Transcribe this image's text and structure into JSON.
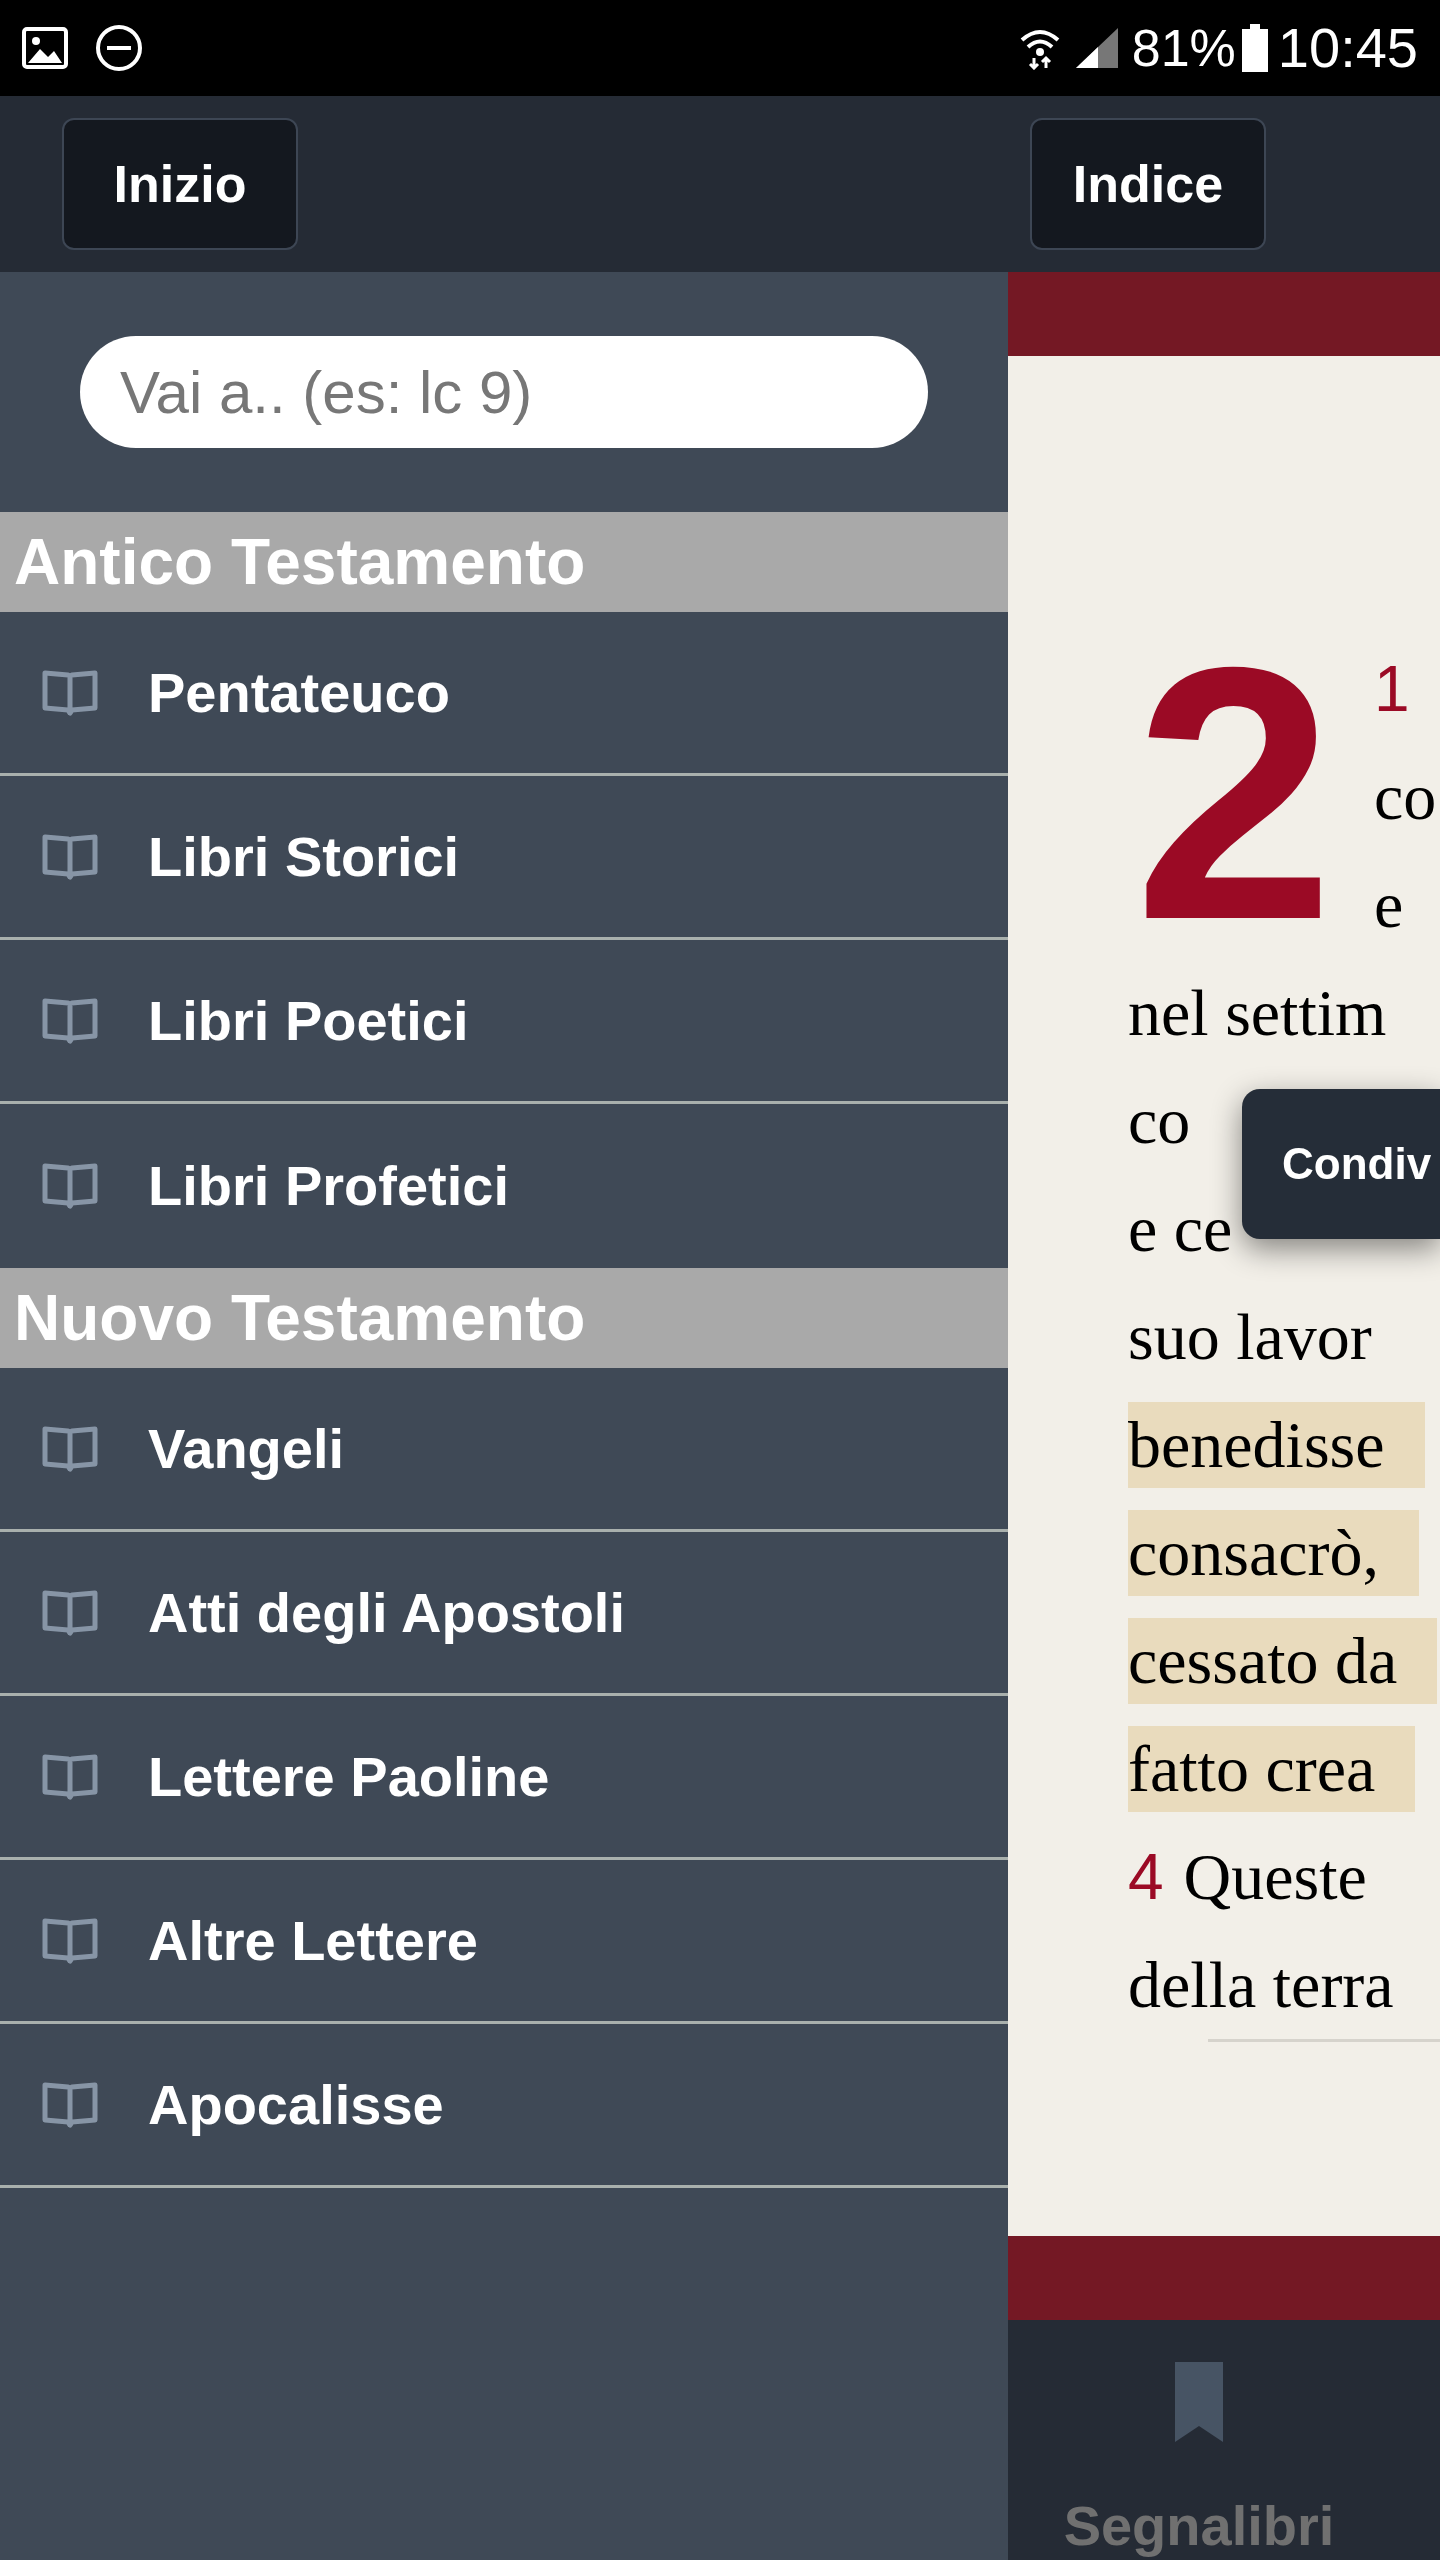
{
  "status_bar": {
    "battery": "81%",
    "time": "10:45"
  },
  "header": {
    "left_button": "Inizio",
    "right_button": "Indice"
  },
  "search": {
    "placeholder": "Vai a.. (es: lc 9)"
  },
  "sections": [
    {
      "title": "Antico Testamento",
      "items": [
        "Pentateuco",
        "Libri Storici",
        "Libri Poetici",
        "Libri Profetici"
      ]
    },
    {
      "title": "Nuovo Testamento",
      "items": [
        "Vangeli",
        "Atti degli Apostoli",
        "Lettere Paoline",
        "Altre Lettere",
        "Apocalisse"
      ]
    }
  ],
  "reader": {
    "chapter": "2",
    "verse_number": "1",
    "drop_lines": [
      "co",
      "e"
    ],
    "lines": [
      {
        "text": "nel settim",
        "highlighted": false
      },
      {
        "text": "co",
        "highlighted": false
      },
      {
        "text": "e ce",
        "highlighted": false
      },
      {
        "text": "suo lavor",
        "highlighted": false
      },
      {
        "text": "benedisse",
        "highlighted": true
      },
      {
        "text": "consacrò,",
        "highlighted": true
      },
      {
        "text": "cessato da",
        "highlighted": true
      },
      {
        "text": "fatto crea",
        "highlighted": true
      },
      {
        "text": "Queste",
        "verse": "4",
        "highlighted": false
      },
      {
        "text": "della terra",
        "highlighted": false
      }
    ],
    "popup": "Condiv"
  },
  "bottom_nav": {
    "label": "Segnalibri"
  }
}
